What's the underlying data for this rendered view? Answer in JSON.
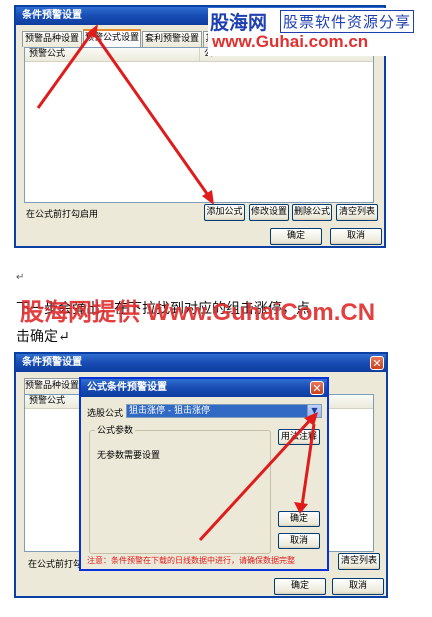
{
  "watermark": {
    "site": "股海网",
    "slogan": "股票软件资源分享",
    "url": "www.Guhai.com.cn"
  },
  "top_dialog": {
    "title": "条件预警设置",
    "tabs": [
      "预警品种设置",
      "预警公式设置",
      "套利预警设置",
      "其"
    ],
    "column_header": "预警公式",
    "column_header_2": "公",
    "footer_note": "在公式前打勾启用",
    "actions": [
      "添加公式",
      "修改设置",
      "删除公式",
      "清空列表"
    ],
    "ok": "确定",
    "cancel": "取消"
  },
  "doc_text": {
    "mark1": "↵",
    "line1": "下一步会弹出，在下拉找到对应的组击涨停，点",
    "line2": "击确定↵",
    "overlay": "股海网提供 Www.GuhaiCom.CN"
  },
  "bottom_dialog": {
    "title": "条件预警设置",
    "tab_partial": "预警品种设置",
    "column_header": "预警公式",
    "footer_note": "在公式前打勾",
    "clear_button": "清空列表",
    "ok": "确定",
    "cancel": "取消"
  },
  "sub_dialog": {
    "title": "公式条件预警设置",
    "select_label": "选股公式",
    "select_value": "狙击涨停 - 狙击涨停",
    "params_group": "公式参数",
    "params_text": "无参数需要设置",
    "usage_button": "用法注释",
    "ok": "确定",
    "cancel": "取消",
    "warning": "注意：条件预警在下载的日线数据中进行，请确保数据完整"
  },
  "colors": {
    "accent_red": "#e01b1b",
    "title_blue": "#0d3c9e",
    "watermark_red": "#e03030"
  }
}
